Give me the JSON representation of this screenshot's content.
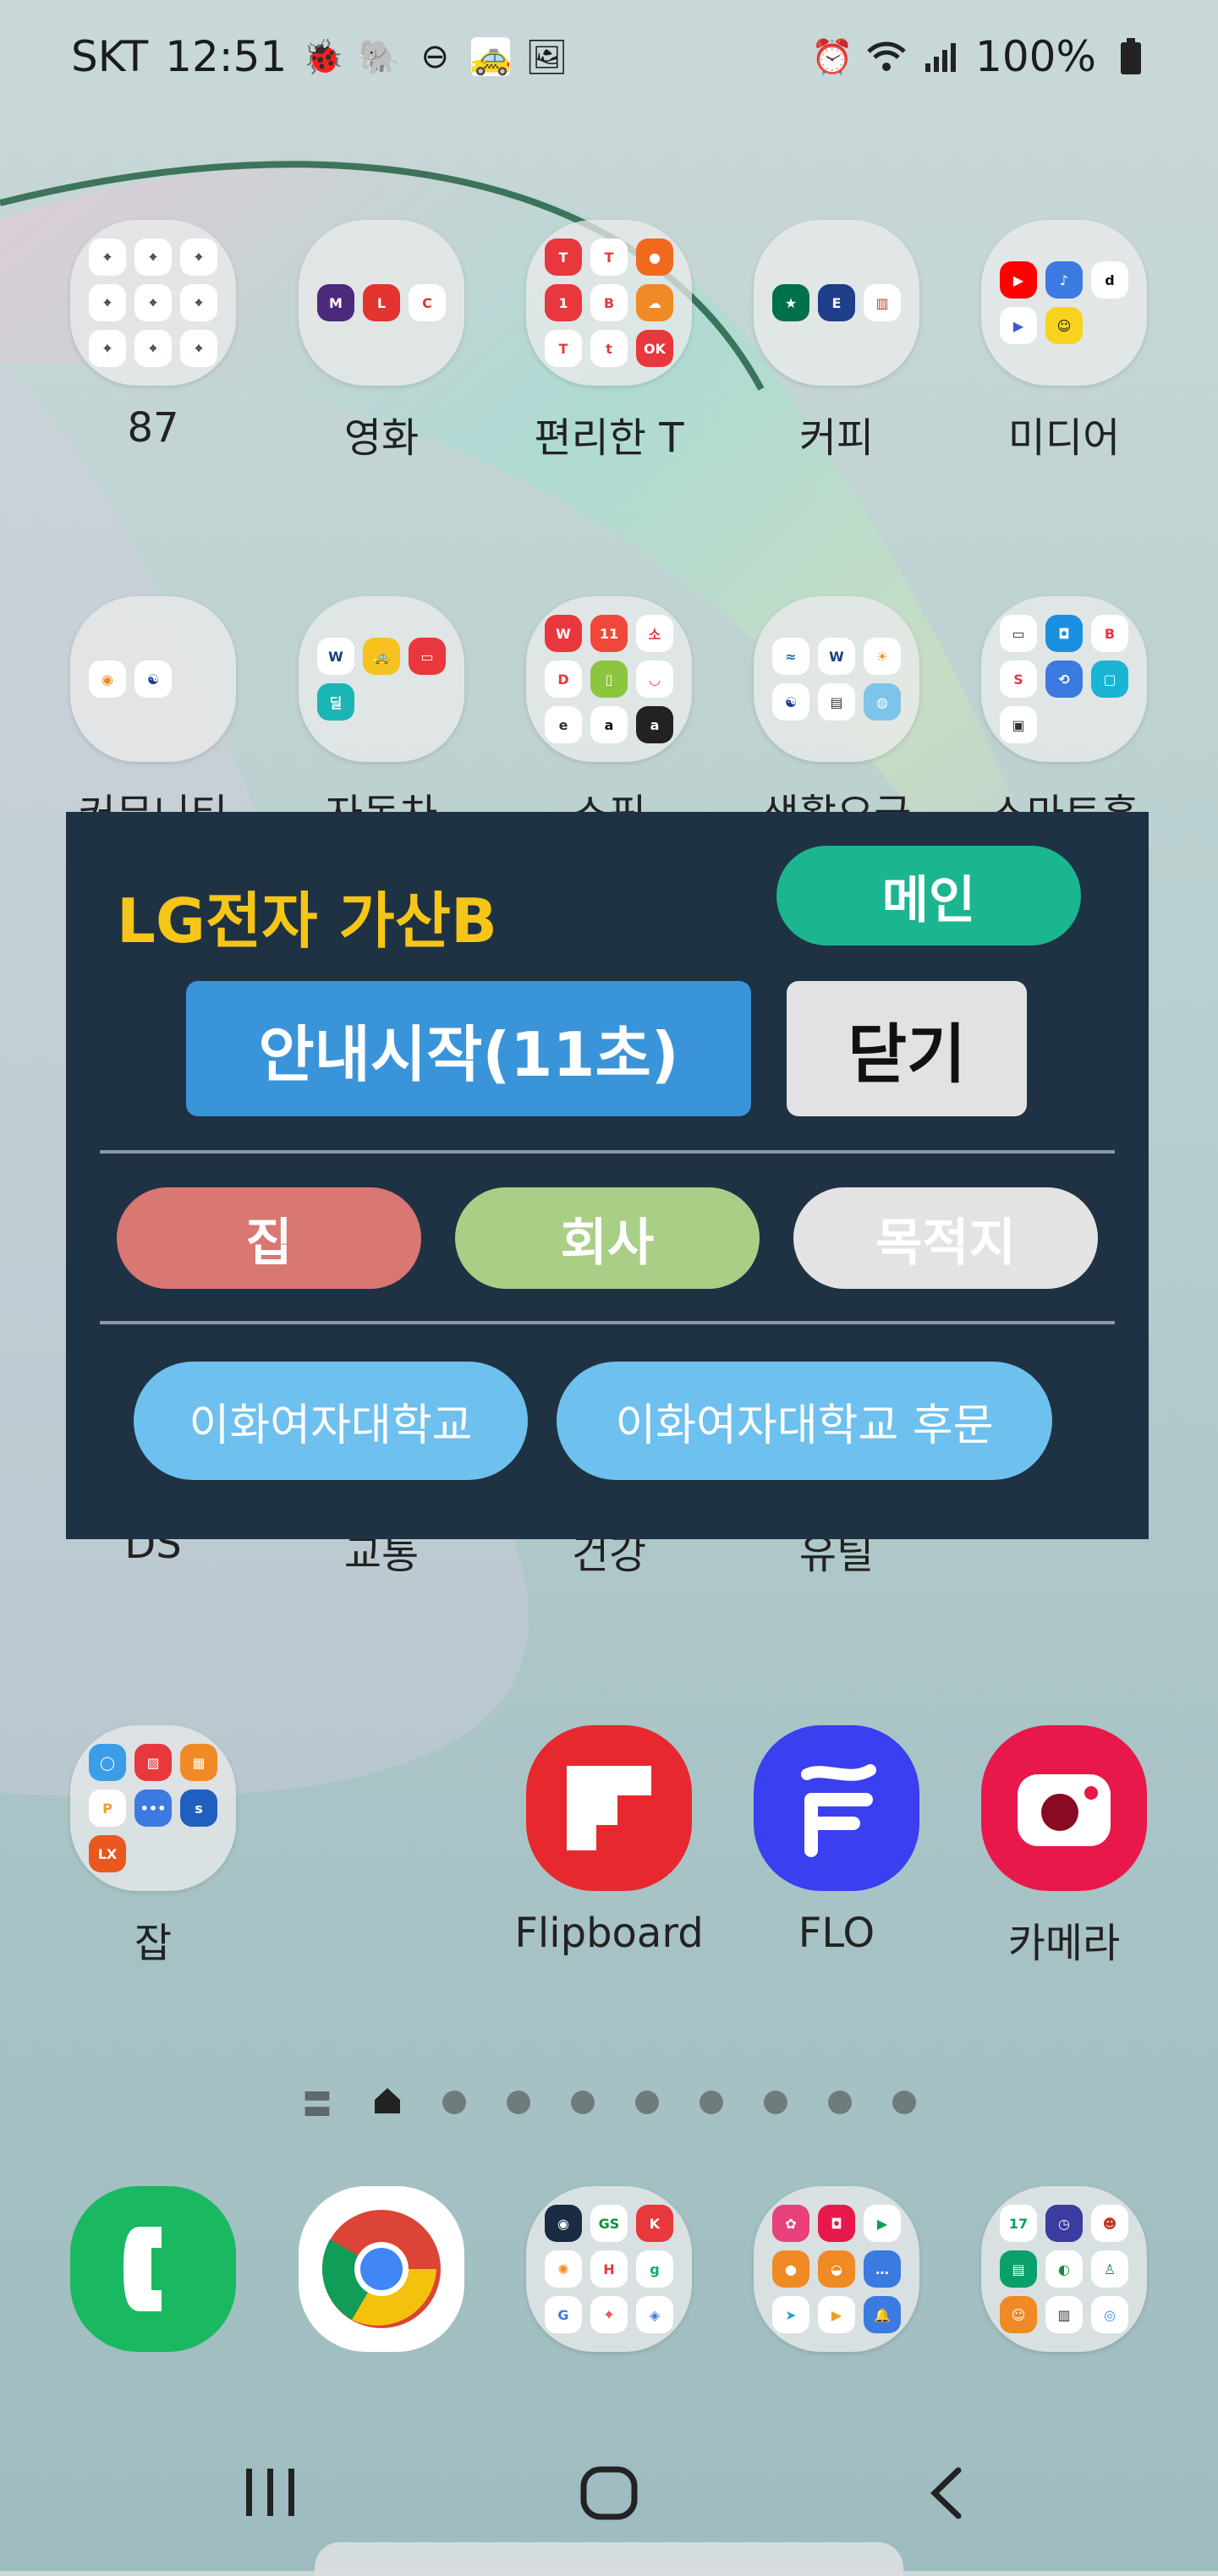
{
  "status": {
    "carrier": "SKT",
    "time": "12:51",
    "battery": "100%",
    "left_icons": [
      "bug-icon",
      "elephant-icon",
      "dnd-icon",
      "taxi-icon",
      "image-icon"
    ],
    "right_icons": [
      "alarm-icon",
      "wifi-icon",
      "signal-icon",
      "battery-icon"
    ]
  },
  "apps_row1": [
    {
      "label": "87"
    },
    {
      "label": "영화"
    },
    {
      "label": "편리한 T"
    },
    {
      "label": "커피"
    },
    {
      "label": "미디어"
    }
  ],
  "apps_row2": [
    {
      "label": "커뮤니티"
    },
    {
      "label": "자동차"
    },
    {
      "label": "쇼핑"
    },
    {
      "label": "생활요금"
    },
    {
      "label": "스마트홈"
    }
  ],
  "apps_row3": [
    {
      "label": "DS"
    },
    {
      "label": "교통"
    },
    {
      "label": "건강"
    },
    {
      "label": "유틸"
    }
  ],
  "apps_row4": [
    {
      "label": "잡"
    },
    {
      "label": "Flipboard"
    },
    {
      "label": "FLO"
    },
    {
      "label": "카메라"
    }
  ],
  "overlay": {
    "title": "LG전자 가산B",
    "main_button": "메인",
    "start_button": "안내시작(11초)",
    "close_button": "닫기",
    "home_button": "집",
    "work_button": "회사",
    "dest_button": "목적지",
    "fav1": "이화여자대학교",
    "fav2": "이화여자대학교 후문"
  },
  "pager": {
    "pages": 9,
    "current": 0
  },
  "colors": {
    "overlay_bg": "#1f3243",
    "title": "#f5c518",
    "main_btn": "#1bb58f",
    "start_btn": "#3a94da",
    "close_btn": "#e2e2e2",
    "home_btn": "#d97773",
    "work_btn": "#a9cf87",
    "dest_btn": "#e3e3e3",
    "fav_btn": "#6ec0ef"
  }
}
